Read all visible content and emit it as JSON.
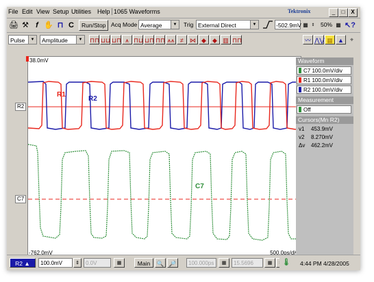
{
  "menu": {
    "items": [
      "File",
      "Edit",
      "View",
      "Setup",
      "Utilities",
      "Help"
    ],
    "waveform_count": "1065 Waveforms",
    "brand": "Tektronix",
    "window_buttons": [
      "_",
      "□",
      "X"
    ]
  },
  "toolbar": {
    "run_stop": "Run/Stop",
    "acq_mode_label": "Acq Mode",
    "acq_mode_value": "Average",
    "trig_label": "Trig",
    "trig_value": "External Direct",
    "trig_level": "-502.9mV",
    "zoom_percent": "50%"
  },
  "toolbar2": {
    "meas_source": "Pulse",
    "meas_param": "Amplitude"
  },
  "screen": {
    "top_label": "38.0mV",
    "bottom_left_label": "-762.0mV",
    "bottom_right_label": "500.0ps/div",
    "labels": {
      "r1": "R1",
      "r2": "R2",
      "c7": "C7"
    },
    "left_markers": {
      "r2": "R2",
      "c7": "C7"
    },
    "colors": {
      "r1": "#e8261c",
      "r2": "#1a1aa8",
      "c7": "#2f8f3a"
    }
  },
  "side_panel": {
    "waveform_header": "Waveform",
    "waveforms": [
      {
        "name": "C7 100.0mV/div",
        "color": "#2f8f3a"
      },
      {
        "name": "R1 100.0mV/div",
        "color": "#e8261c"
      },
      {
        "name": "R2 100.0mV/div",
        "color": "#1a1aa8"
      }
    ],
    "measurement_header": "Measurement",
    "measurement_value": "Off",
    "cursors_header": "Cursors(Mn R2)",
    "cursors": [
      {
        "label": "v1",
        "value": "453.9mV"
      },
      {
        "label": "v2",
        "value": "8.270mV"
      },
      {
        "label": "Δv",
        "value": "462.2mV"
      }
    ]
  },
  "status": {
    "channel": "R2",
    "scale": "100.0mV",
    "offset": "0.0V",
    "main_label": "Main",
    "position": "100.000ps",
    "record": "15.5696",
    "time": "4:44 PM 4/28/2005"
  }
}
